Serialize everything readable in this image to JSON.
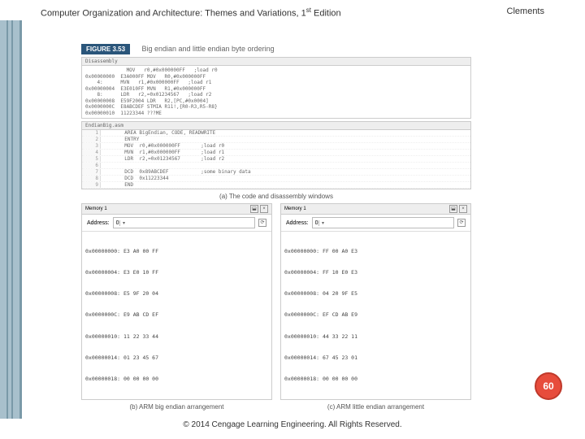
{
  "header": {
    "title": "Computer Organization and Architecture: Themes and Variations, 1",
    "sup": "st",
    "title2": " Edition",
    "author": "Clements"
  },
  "figure": {
    "label": "FIGURE 3.53",
    "title": "Big endian and little endian byte ordering"
  },
  "disassembly": {
    "header": "Disassembly",
    "lines": [
      "              MOV   r0,#0x000000FF   ;load r0",
      "0x00000000  E3A000FF MOV   R0,#0x000000FF",
      "    4:      MVN   r1,#0x000000FF   ;load r1",
      "0x00000004  E3E010FF MVN   R1,#0x000000FF",
      "    8:      LDR   r2,=0x01234567   ;load r2",
      "0x00000008  E59F2004 LDR   R2,[PC,#0x0004]",
      "0x0000000C  E8ABCDEF STMIA R11!,{R0-R3,R5-R8}",
      "0x00000010  11223344 ???ME"
    ]
  },
  "code": {
    "header": "EndianBig.asm",
    "rows": [
      {
        "n": "1",
        "t": "       AREA BigEndian, CODE, READWRITE"
      },
      {
        "n": "2",
        "t": "       ENTRY"
      },
      {
        "n": "3",
        "t": "       MOV  r0,#0x000000FF       ;load r0"
      },
      {
        "n": "4",
        "t": "       MVN  r1,#0x000000FF       ;load r1"
      },
      {
        "n": "5",
        "t": "       LDR  r2,=0x01234567       ;load r2"
      },
      {
        "n": "6",
        "t": ""
      },
      {
        "n": "7",
        "t": "       DCD  0x89ABCDEF           ;some binary data"
      },
      {
        "n": "8",
        "t": "       DCD  0x11223344"
      },
      {
        "n": "9",
        "t": "       END"
      }
    ]
  },
  "captionA": "(a) The code and disassembly windows",
  "memory": {
    "title": "Memory 1",
    "addrLabel": "Address:",
    "addrValue": "0",
    "left": [
      "0x00000000: E3 A0 00 FF",
      "0x00000004: E3 E0 10 FF",
      "0x00000008: E5 9F 20 04",
      "0x0000000C: E9 AB CD EF",
      "0x00000010: 11 22 33 44",
      "0x00000014: 01 23 45 67",
      "0x00000018: 00 00 00 00"
    ],
    "right": [
      "0x00000000: FF 00 A0 E3",
      "0x00000004: FF 10 E0 E3",
      "0x00000008: 04 20 9F E5",
      "0x0000000C: EF CD AB E9",
      "0x00000010: 44 33 22 11",
      "0x00000014: 67 45 23 01",
      "0x00000018: 00 00 00 00"
    ]
  },
  "captionB": "(b) ARM big endian arrangement",
  "captionC": "(c) ARM little endian arrangement",
  "page": "60",
  "footer": "© 2014 Cengage Learning Engineering. All Rights Reserved."
}
